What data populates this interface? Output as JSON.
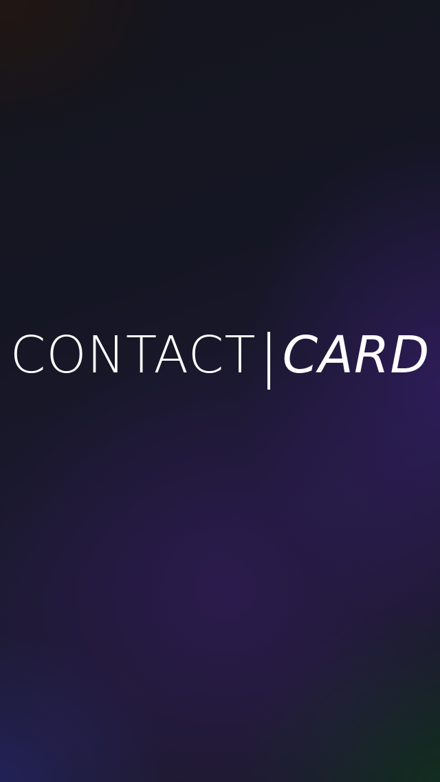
{
  "splash": {
    "logo_part_1": "CONTACT",
    "logo_divider": "|",
    "logo_part_2": "CARD"
  },
  "colors": {
    "text": "#ffffff",
    "background_dark": "#151624",
    "background_purple": "#2a1c4d",
    "background_green": "#10301e"
  }
}
